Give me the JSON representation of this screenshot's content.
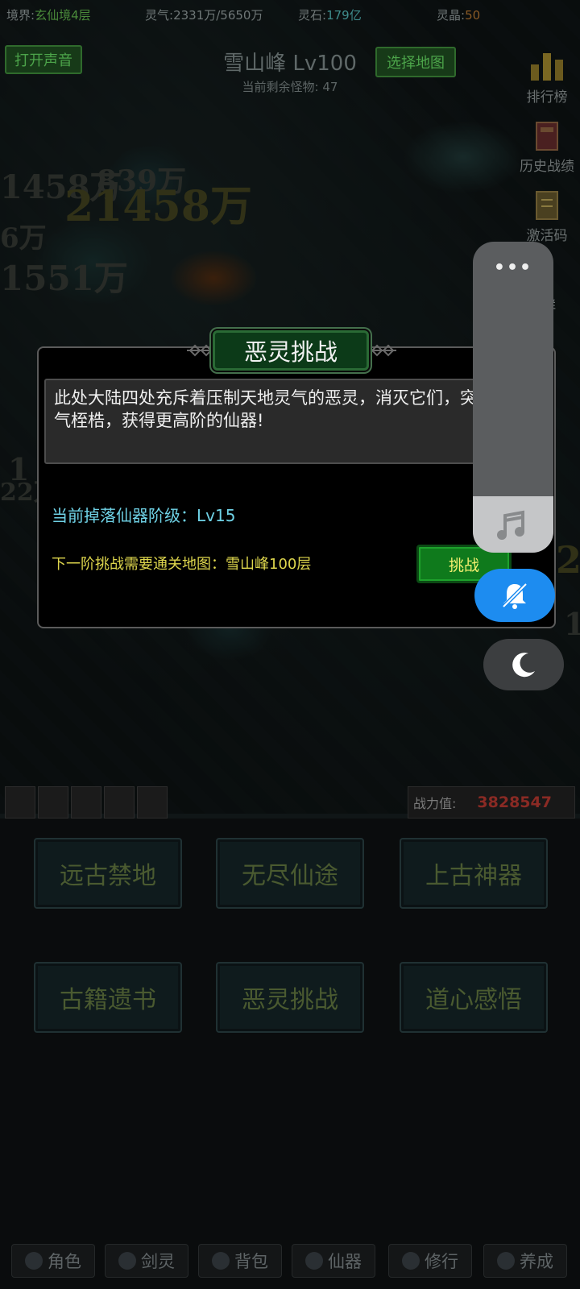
{
  "topbar": {
    "realm_label": "境界:",
    "realm_value": "玄仙境4层",
    "qi_label": "灵气:",
    "qi_value": "2331万/5650万",
    "stone_label": "灵石:",
    "stone_value": "179亿",
    "crystal_label": "灵晶:",
    "crystal_value": "50"
  },
  "header": {
    "sound_button": "打开声音",
    "map_title": "雪山峰 Lv100",
    "select_map_button": "选择地图",
    "remaining_monsters": "当前剩余怪物: 47"
  },
  "side_menu": {
    "ranking": "排行榜",
    "history": "历史战绩",
    "activation": "激活码",
    "join_group": "加群"
  },
  "damage_numbers": {
    "n1": "1458万",
    "n2": "839万",
    "n3": "21458万",
    "n4": "6万",
    "n5": "1551万",
    "n6": "1",
    "n7": "22万",
    "n8": "2",
    "n9": "1"
  },
  "dialog": {
    "title": "恶灵挑战",
    "description": "此处大陆四处充斥着压制天地灵气的恶灵，消灭它们，突破灵气桎梏，获得更高阶的仙器!",
    "drop_level": "当前掉落仙器阶级：Lv15",
    "next_requirement": "下一阶挑战需要通关地图：雪山峰100层",
    "challenge_button": "挑战"
  },
  "system_overlay": {
    "more_dots": "•••",
    "music_icon": "music-note-icon",
    "mute_icon": "bell-off-icon",
    "night_icon": "moon-icon",
    "mute_color": "#1d8cf0"
  },
  "power": {
    "label": "战力值:",
    "value": "3828547"
  },
  "menu": {
    "row1": [
      "远古禁地",
      "无尽仙途",
      "上古神器"
    ],
    "row2": [
      "古籍遗书",
      "恶灵挑战",
      "道心感悟"
    ]
  },
  "tabs": [
    "角色",
    "剑灵",
    "背包",
    "仙器",
    "修行",
    "养成"
  ]
}
